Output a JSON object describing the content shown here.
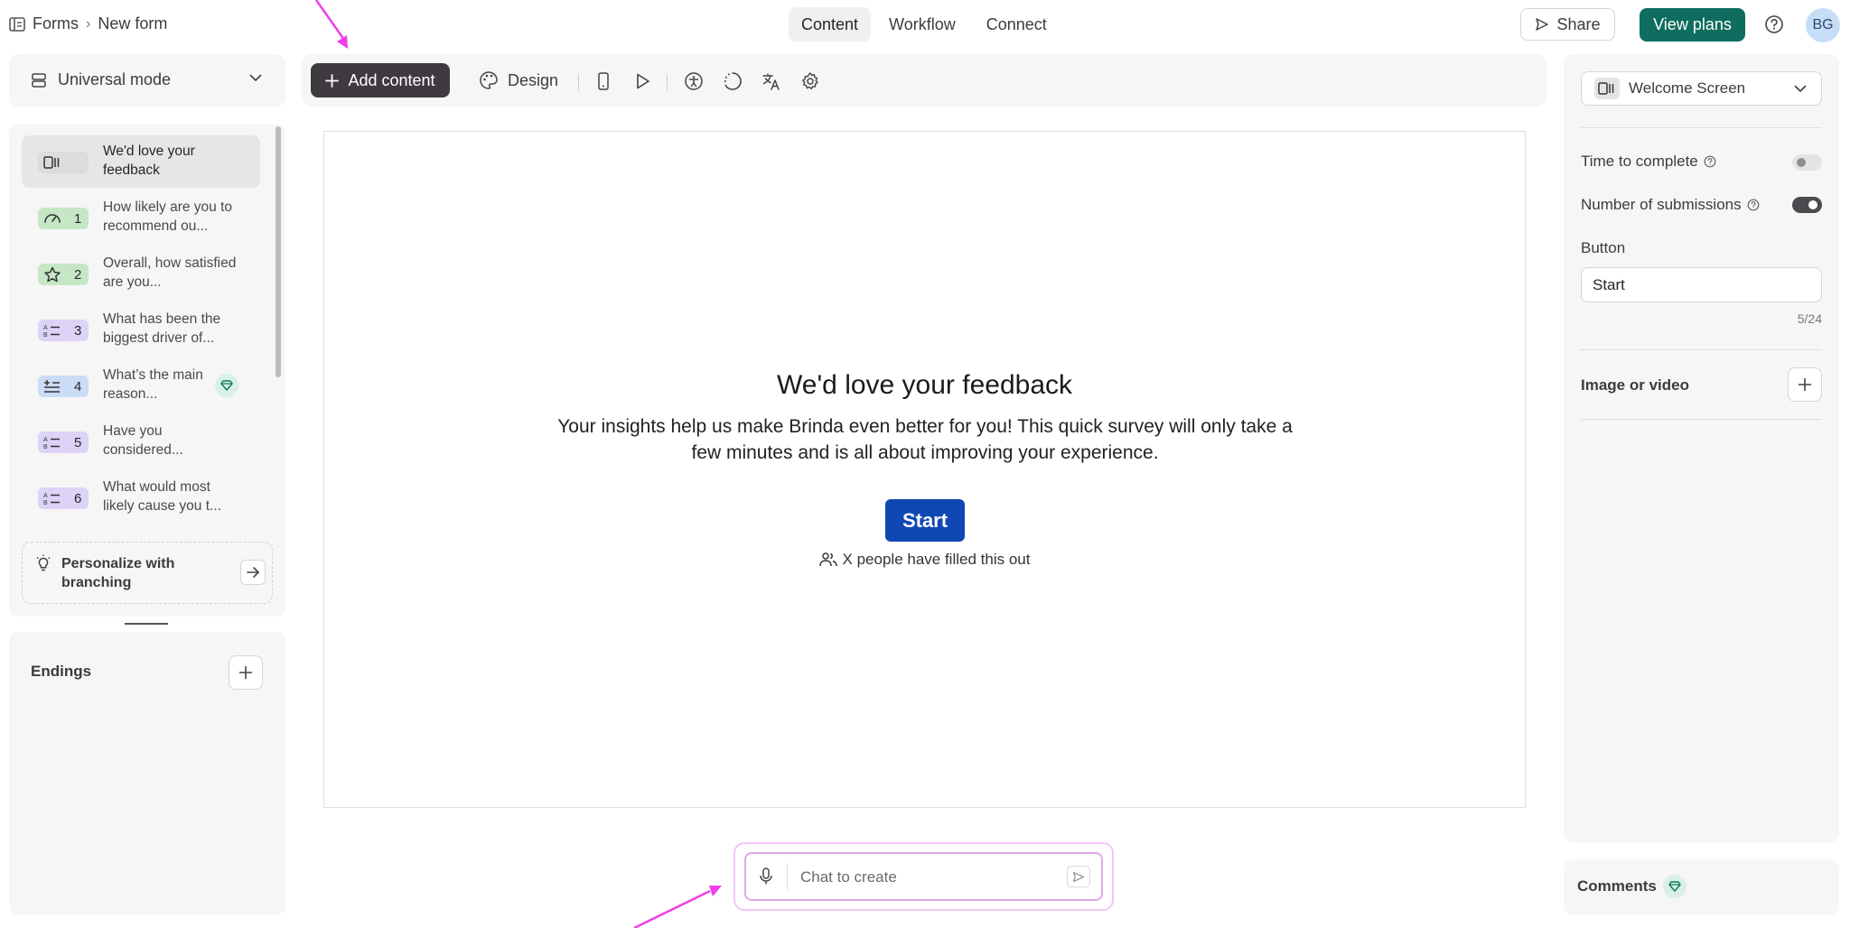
{
  "breadcrumb": {
    "root": "Forms",
    "current": "New form"
  },
  "nav_tabs": [
    {
      "label": "Content",
      "active": true
    },
    {
      "label": "Workflow",
      "active": false
    },
    {
      "label": "Connect",
      "active": false
    }
  ],
  "header": {
    "share_label": "Share",
    "plans_label": "View plans",
    "avatar_initials": "BG",
    "plans_color": "#0e6d5e"
  },
  "sidebar": {
    "mode_label": "Universal mode",
    "questions": [
      {
        "number": "",
        "text": "We'd love your feedback",
        "icon": "welcome-screen-icon",
        "color": "#e0e0e0",
        "selected": true
      },
      {
        "number": "1",
        "text": "How likely are you to recommend ou...",
        "icon": "gauge-icon",
        "color": "#c6e7c6",
        "selected": false
      },
      {
        "number": "2",
        "text": "Overall, how satisfied are you...",
        "icon": "star-icon",
        "color": "#c6e7c6",
        "selected": false
      },
      {
        "number": "3",
        "text": "What has been the biggest driver of...",
        "icon": "ranking-icon",
        "color": "#ddd3f7",
        "selected": false
      },
      {
        "number": "4",
        "text": "What’s the main reason...",
        "icon": "matrix-icon",
        "color": "#cbdcf7",
        "selected": false
      },
      {
        "number": "5",
        "text": "Have you considered...",
        "icon": "ranking-icon",
        "color": "#ddd3f7",
        "selected": false
      },
      {
        "number": "6",
        "text": "What would most likely cause you t...",
        "icon": "ranking-icon",
        "color": "#ddd3f7",
        "selected": false
      }
    ],
    "personalize_label": "Personalize with branching",
    "endings_label": "Endings"
  },
  "toolbar": {
    "add_content_label": "Add content",
    "design_label": "Design"
  },
  "canvas": {
    "title": "We'd love your feedback",
    "description": "Your insights help us make Brinda even better for you! This quick survey will only take a few minutes and is all about improving your experience.",
    "button_label": "Start",
    "button_color": "#0f47b3",
    "responses_text": "X people have filled this out"
  },
  "chat": {
    "placeholder": "Chat to create"
  },
  "settings": {
    "screen_label": "Welcome Screen",
    "time_to_complete_label": "Time to complete",
    "time_to_complete_on": false,
    "submissions_label": "Number of submissions",
    "submissions_on": true,
    "button_section_label": "Button",
    "button_value": "Start",
    "char_counter": "5/24",
    "media_label": "Image or video",
    "comments_label": "Comments"
  }
}
